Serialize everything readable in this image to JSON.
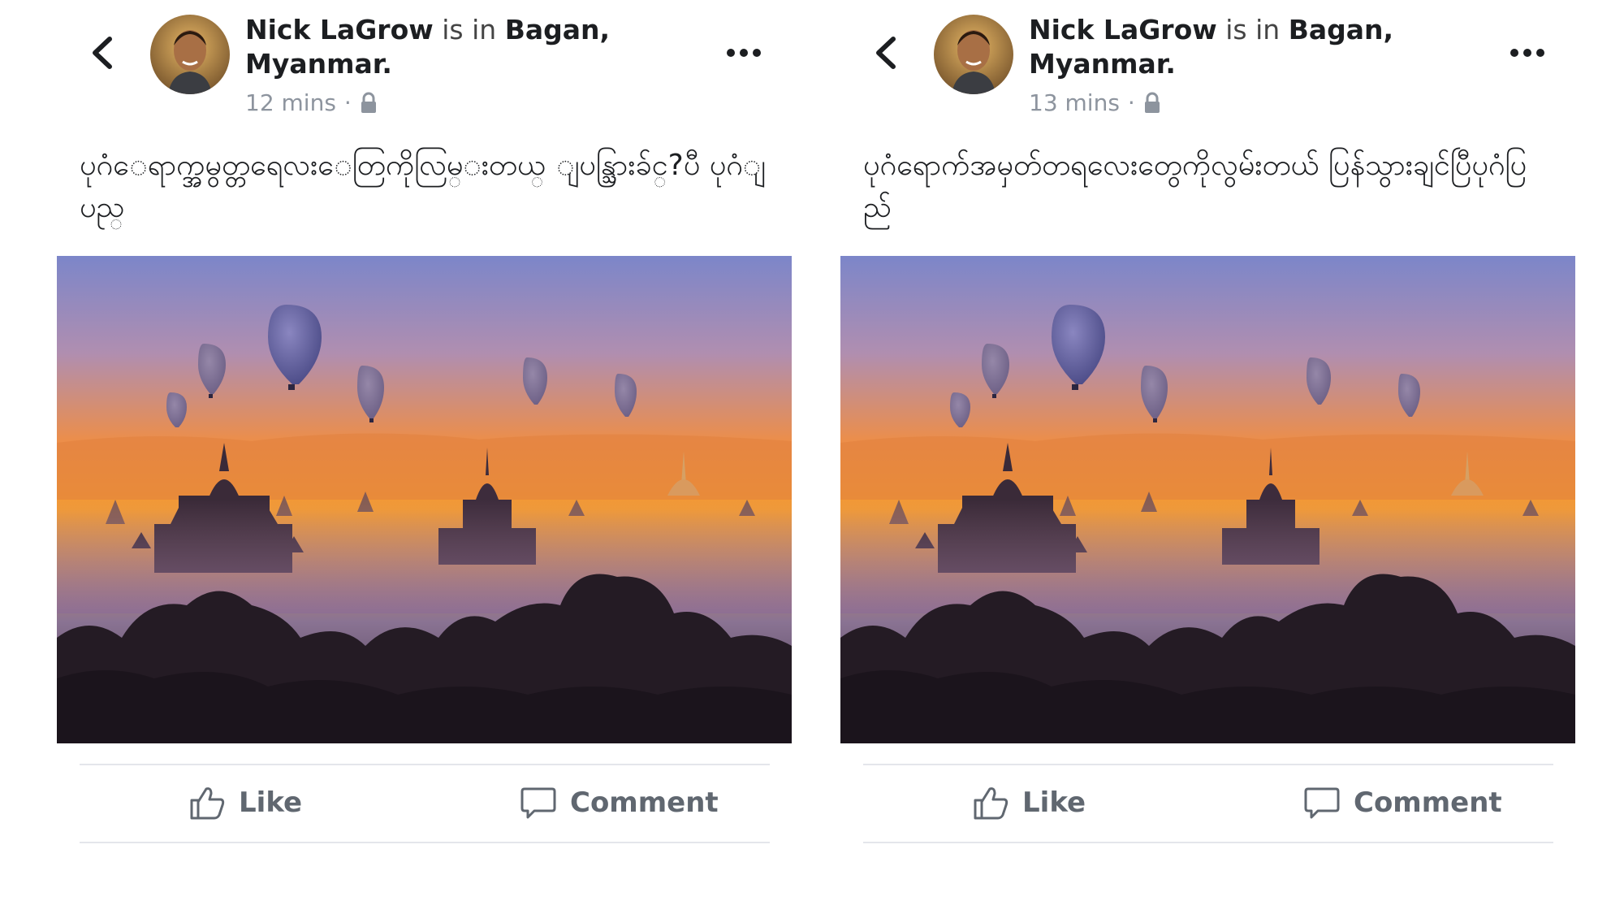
{
  "posts": [
    {
      "author": "Nick LaGrow",
      "verb": "is in",
      "place_line1": "Bagan,",
      "place_line2": "Myanmar.",
      "time": "12 mins",
      "separator": "·",
      "privacy_icon": "lock-icon",
      "text": "ပုဂံေရာက္အမွတ္တရေလးေတြကိုလြမ္းတယ္ ျပန္သြားခ်င္?ပီ ပုဂံျပည္",
      "photo_subject": "hot-air balloons over Bagan temples at sunrise",
      "like_label": "Like",
      "comment_label": "Comment"
    },
    {
      "author": "Nick LaGrow",
      "verb": "is in",
      "place_line1": "Bagan,",
      "place_line2": "Myanmar.",
      "time": "13 mins",
      "separator": "·",
      "privacy_icon": "lock-icon",
      "text": "ပုဂံရောက်အမှတ်တရလေးတွေကိုလွမ်းတယ် ပြန်သွားချင်ပြီပုဂံပြည်",
      "photo_subject": "hot-air balloons over Bagan temples at sunrise",
      "like_label": "Like",
      "comment_label": "Comment"
    }
  ],
  "colors": {
    "text_primary": "#1c1e21",
    "text_secondary": "#8d949e",
    "action_label": "#606770",
    "divider": "#e4e6eb"
  }
}
